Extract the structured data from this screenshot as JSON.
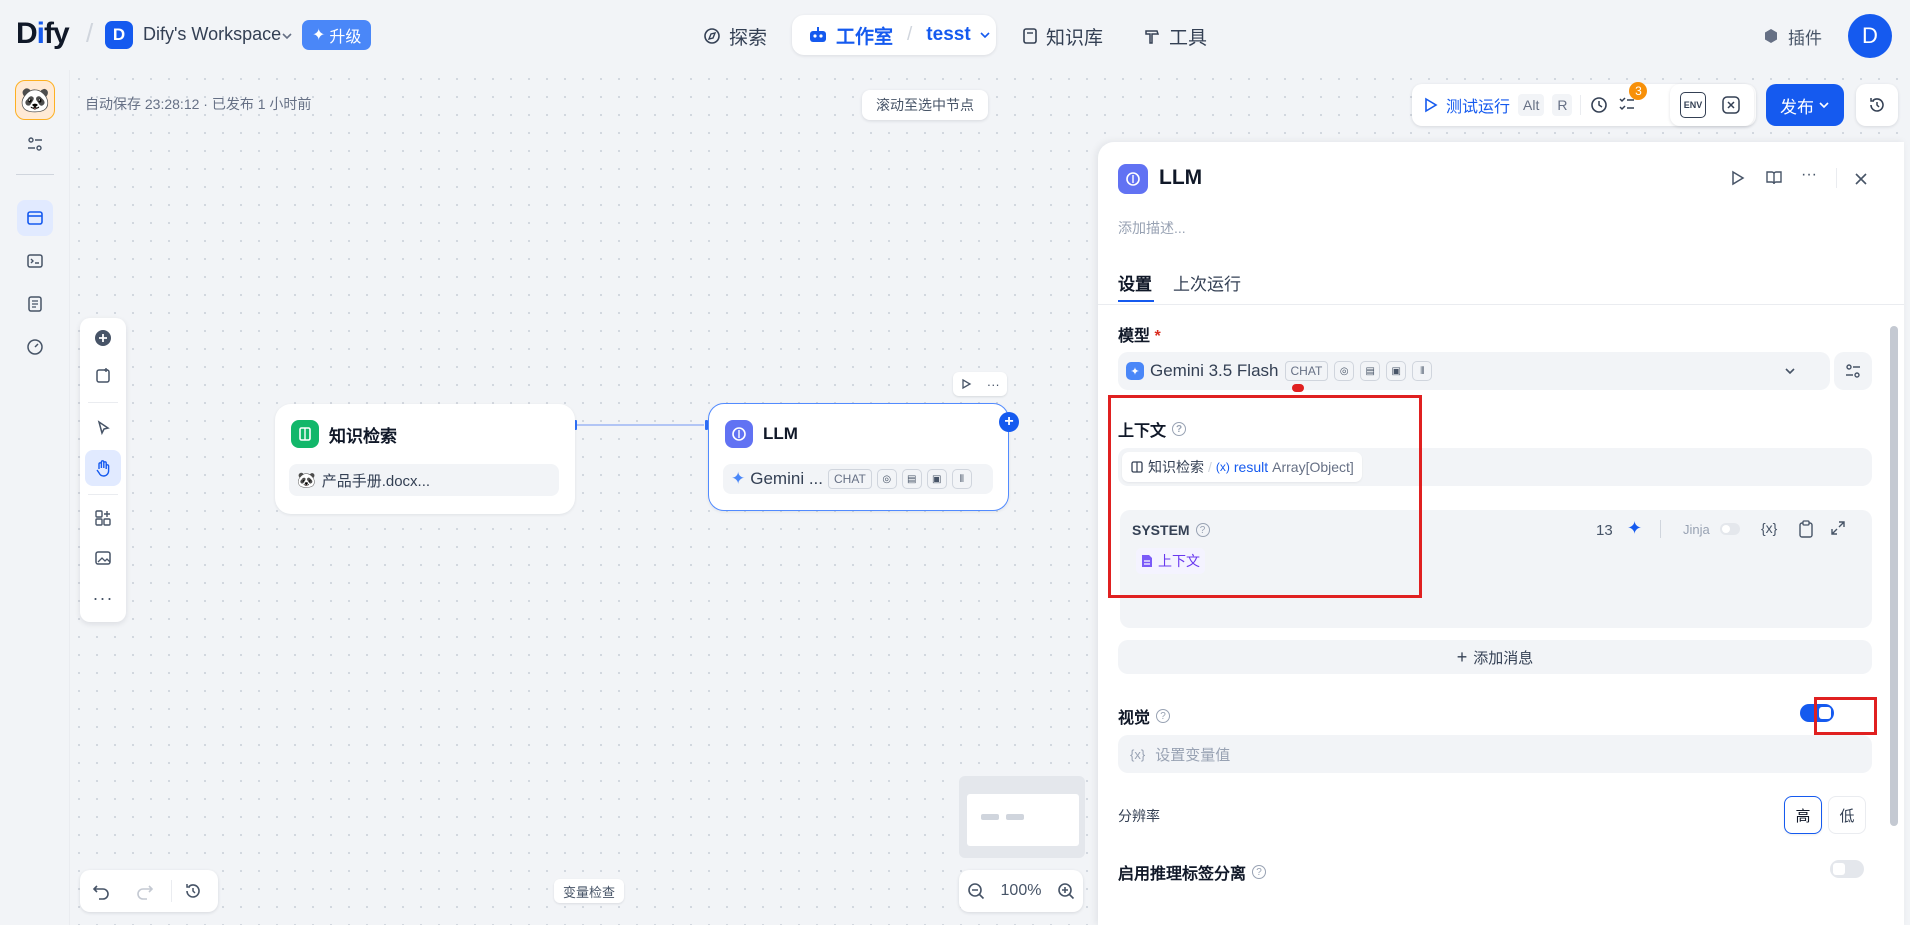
{
  "header": {
    "logo_prefix": "D",
    "logo_i": "i",
    "logo_suffix": "fy",
    "workspace_initial": "D",
    "workspace_name": "Dify's Workspace",
    "upgrade_label": "升级",
    "nav": {
      "explore": "探索",
      "studio": "工作室",
      "app_name": "tesst",
      "knowledge": "知识库",
      "tools": "工具",
      "plugins": "插件"
    },
    "user_initial": "D"
  },
  "canvas": {
    "autosave_text": "自动保存 23:28:12 · 已发布 1 小时前",
    "scroll_to_node": "滚动至选中节点",
    "test_run": "测试运行",
    "shortcut_alt": "Alt",
    "shortcut_r": "R",
    "checklist_count": "3",
    "env_label": "ENV",
    "publish_label": "发布",
    "zoom_level": "100%",
    "variable_check": "变量检查"
  },
  "nodes": {
    "knowledge": {
      "title": "知识检索",
      "file": "产品手册.docx..."
    },
    "llm": {
      "title": "LLM",
      "model": "Gemini ...",
      "tag": "CHAT"
    }
  },
  "panel": {
    "title": "LLM",
    "description_placeholder": "添加描述...",
    "tabs": [
      "设置",
      "上次运行"
    ],
    "model_label": "模型",
    "required_mark": "*",
    "model_name": "Gemini 3.5 Flash",
    "model_tag": "CHAT",
    "context_label": "上下文",
    "context_source": "知识检索",
    "context_sep": "/",
    "context_var": "result",
    "context_type": "Array[Object]",
    "system_label": "SYSTEM",
    "token_count": "13",
    "jinja_label": "Jinja",
    "var_button": "{x}",
    "context_chip": "上下文",
    "add_message": "添加消息",
    "vision_label": "视觉",
    "vision_enabled": true,
    "var_placeholder": "设置变量值",
    "resolution_label": "分辨率",
    "resolution_high": "高",
    "resolution_low": "低",
    "reasoning_label": "启用推理标签分离",
    "reasoning_enabled": false
  },
  "colors": {
    "primary": "#155aef",
    "highlight_box": "#e02020",
    "badge": "#f79009",
    "knowledge_icon": "#12b76a",
    "llm_icon": "#6172f3"
  }
}
